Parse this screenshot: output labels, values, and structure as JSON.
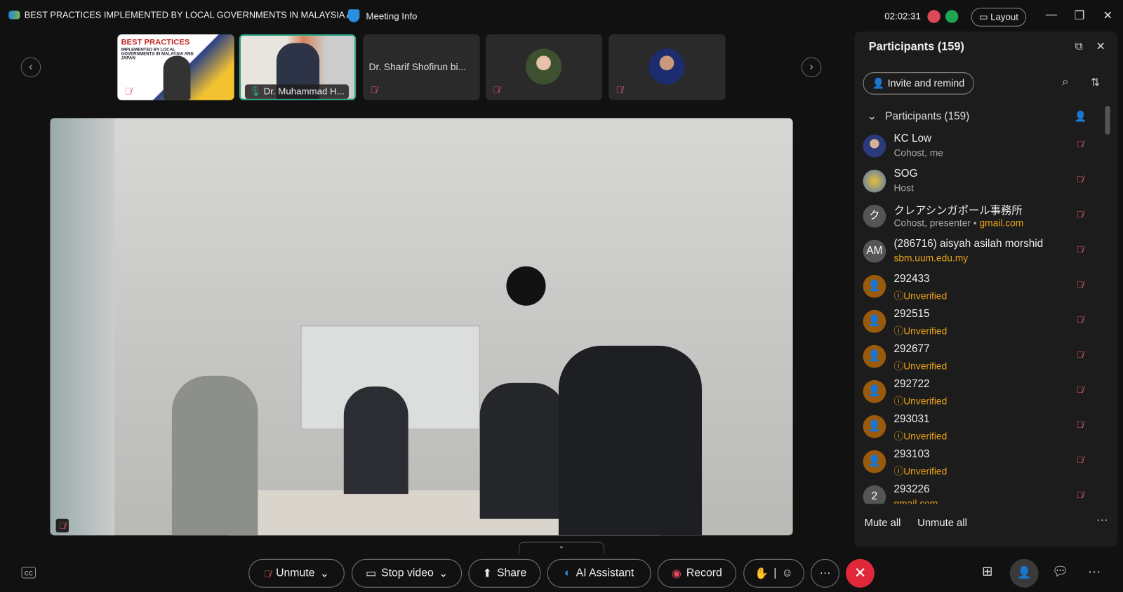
{
  "window": {
    "title": "BEST PRACTICES IMPLEMENTED BY LOCAL GOVERNMENTS IN MALAYSIA A...",
    "meeting_info": "Meeting Info",
    "timer": "02:02:31",
    "layout": "Layout"
  },
  "thumbnails": [
    {
      "name": "",
      "slide_title": "BEST PRACTICES",
      "slide_sub": "IMPLEMENTED BY LOCAL GOVERNMENTS IN MALAYSIA AND JAPAN",
      "muted": true
    },
    {
      "name": "Dr. Muhammad H...",
      "active_speaker": true
    },
    {
      "name": "Dr. Sharif Shofirun bi...",
      "muted": true
    },
    {
      "name": "",
      "muted": true
    },
    {
      "name": "",
      "muted": true
    }
  ],
  "participants": {
    "title": "Participants (159)",
    "invite": "Invite and remind",
    "group": "Participants (159)",
    "list": [
      {
        "name": "KC Low",
        "sub": "Cohost, me",
        "sub2": "",
        "avatar": "photo"
      },
      {
        "name": "SOG",
        "sub": "Host",
        "sub2": "",
        "avatar": "photo"
      },
      {
        "name": "クレアシンガポール事務所",
        "sub": "Cohost, presenter •",
        "sub2": "gmail.com",
        "avatar": "ク"
      },
      {
        "name": "(286716) aisyah asilah morshid",
        "sub": "",
        "sub2": "sbm.uum.edu.my",
        "avatar": "AM"
      },
      {
        "name": "292433",
        "sub": "",
        "sub2": "Unverified",
        "avatar": "user"
      },
      {
        "name": "292515",
        "sub": "",
        "sub2": "Unverified",
        "avatar": "user"
      },
      {
        "name": "292677",
        "sub": "",
        "sub2": "Unverified",
        "avatar": "user"
      },
      {
        "name": "292722",
        "sub": "",
        "sub2": "Unverified",
        "avatar": "user"
      },
      {
        "name": "293031",
        "sub": "",
        "sub2": "Unverified",
        "avatar": "user"
      },
      {
        "name": "293103",
        "sub": "",
        "sub2": "Unverified",
        "avatar": "user"
      },
      {
        "name": "293226",
        "sub": "",
        "sub2": "gmail.com",
        "avatar": "2"
      }
    ],
    "mute_all": "Mute all",
    "unmute_all": "Unmute all"
  },
  "toolbar": {
    "unmute": "Unmute",
    "stop_video": "Stop video",
    "share": "Share",
    "ai": "AI Assistant",
    "record": "Record"
  },
  "colors": {
    "accent_orange": "#e8a21a",
    "mute_red": "#e05868",
    "end_red": "#e0283a",
    "active_green": "#2fa88a"
  }
}
